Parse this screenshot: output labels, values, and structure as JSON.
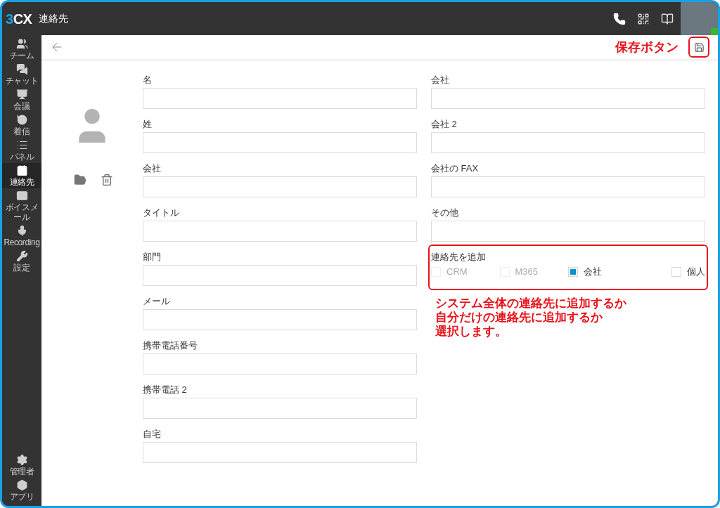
{
  "header": {
    "logo": "3CX",
    "title": "連絡先"
  },
  "sidebar": {
    "items": [
      {
        "label": "チーム",
        "selected": false
      },
      {
        "label": "チャット",
        "selected": false
      },
      {
        "label": "会議",
        "selected": false
      },
      {
        "label": "着信",
        "selected": false
      },
      {
        "label": "パネル",
        "selected": false
      },
      {
        "label": "連絡先",
        "selected": true
      },
      {
        "label": "ボイスメール",
        "selected": false
      },
      {
        "label": "Recording",
        "selected": false
      },
      {
        "label": "設定",
        "selected": false
      }
    ],
    "bottom_items": [
      {
        "label": "管理者",
        "selected": false
      },
      {
        "label": "アプリ",
        "selected": false
      }
    ]
  },
  "user": {
    "online": true
  },
  "save_callout": "保存ボタン",
  "form": {
    "left_fields": [
      {
        "label": "名"
      },
      {
        "label": "姓"
      },
      {
        "label": "会社"
      },
      {
        "label": "タイトル"
      },
      {
        "label": "部門"
      },
      {
        "label": "メール"
      },
      {
        "label": "携帯電話番号"
      },
      {
        "label": "携帯電話 2"
      },
      {
        "label": "自宅"
      }
    ],
    "right_fields": [
      {
        "label": "会社"
      },
      {
        "label": "会社 2"
      },
      {
        "label": "会社の FAX"
      },
      {
        "label": "その他"
      }
    ],
    "add_to": {
      "label": "連絡先を追加",
      "options": [
        {
          "label": "CRM",
          "checked": false,
          "disabled": true
        },
        {
          "label": "M365",
          "checked": false,
          "disabled": true
        },
        {
          "label": "会社",
          "checked": true,
          "disabled": false
        },
        {
          "label": "個人",
          "checked": false,
          "disabled": false
        }
      ]
    }
  },
  "annotation_lines": [
    "システム全体の連絡先に追加するか",
    "自分だけの連絡先に追加するか",
    "選択します。"
  ]
}
